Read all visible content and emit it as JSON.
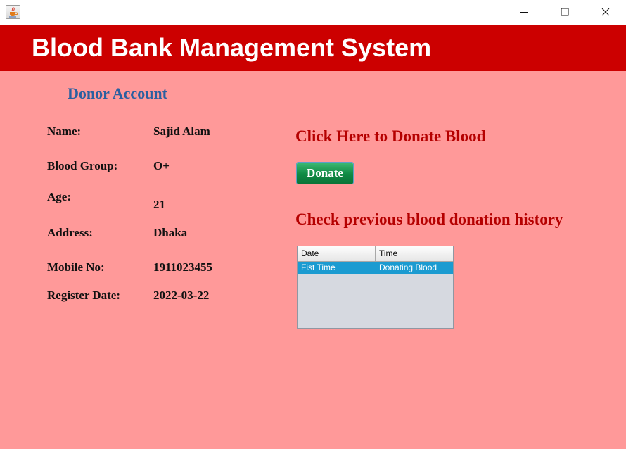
{
  "window": {
    "app_icon": "java-cup-icon",
    "controls": [
      "minimize-icon",
      "maximize-icon",
      "close-icon"
    ]
  },
  "header": {
    "title": "Blood Bank Management System"
  },
  "section_title": "Donor Account",
  "profile": {
    "name_label": "Name:",
    "name_value": "Sajid Alam",
    "blood_group_label": "Blood Group:",
    "blood_group_value": "O+",
    "age_label": "Age:",
    "age_value": "21",
    "address_label": "Address:",
    "address_value": "Dhaka",
    "mobile_label": "Mobile No:",
    "mobile_value": "1911023455",
    "register_date_label": "Register Date:",
    "register_date_value": "2022-03-22"
  },
  "donate": {
    "heading": "Click Here to Donate Blood",
    "button_label": "Donate"
  },
  "history": {
    "heading": "Check previous blood donation history",
    "columns": [
      "Date",
      "Time"
    ],
    "rows": [
      {
        "date": "Fist Time",
        "time": "Donating Blood",
        "selected": true
      }
    ]
  },
  "colors": {
    "background": "#ff9999",
    "header": "#cc0000",
    "section_title": "#2a5fa0",
    "headings": "#b50000",
    "button": "#0f8a44",
    "row_selected": "#1b9bd1"
  }
}
